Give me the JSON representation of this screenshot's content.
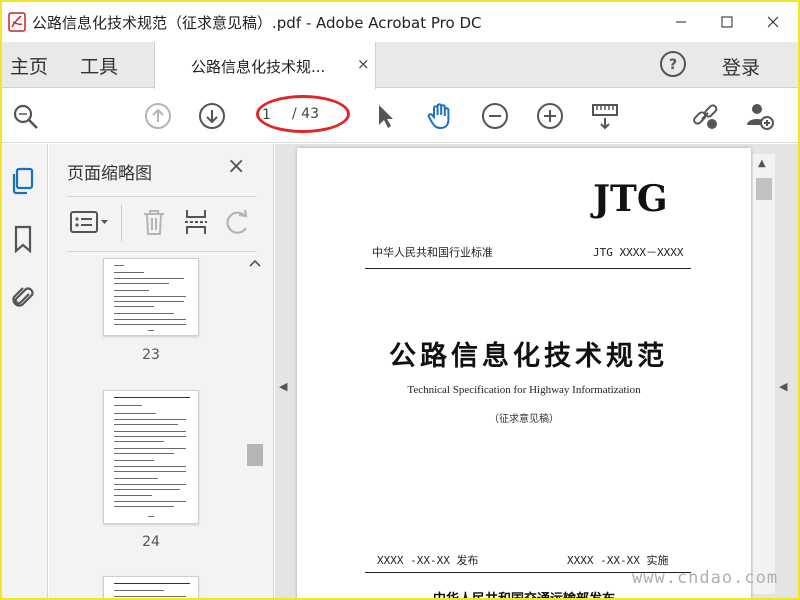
{
  "window": {
    "title": "公路信息化技术规范（征求意见稿）.pdf - Adobe Acrobat Pro DC"
  },
  "tabbar": {
    "home_label": "主页",
    "tools_label": "工具",
    "doc_tab_label": "公路信息化技术规...",
    "doc_tab_close": "×",
    "help_label": "?",
    "login_label": "登录"
  },
  "toolbar": {
    "page_current": "1",
    "page_total": "/ 43",
    "icons": [
      "search-icon",
      "page-up-icon",
      "page-down-icon",
      "select-arrow-icon",
      "hand-icon",
      "zoom-out-icon",
      "zoom-in-icon",
      "measure-icon",
      "share-link-icon",
      "add-user-icon"
    ]
  },
  "leftrail": {
    "icons": [
      "page-thumbnails-icon",
      "bookmark-icon",
      "attachment-icon"
    ]
  },
  "thumb_panel": {
    "title": "页面缩略图",
    "close": "×",
    "thumbnails": [
      {
        "page_label": "23"
      },
      {
        "page_label": "24"
      }
    ]
  },
  "document": {
    "header_code": "JTG",
    "standard_left": "中华人民共和国行业标准",
    "standard_right": "JTG XXXX－XXXX",
    "title_cn": "公路信息化技术规范",
    "title_en": "Technical Specification for Highway Informatization",
    "draft_note": "（征求意见稿）",
    "publish_date": "XXXX -XX-XX  发布",
    "implement_date": "XXXX -XX-XX  实施",
    "issuer": "中华人民共和国交通运输部发布"
  },
  "watermark": "www.cndao.com",
  "colors": {
    "frame": "#f0e628",
    "highlight": "#e42525",
    "accent_blue": "#1b6fc2"
  }
}
